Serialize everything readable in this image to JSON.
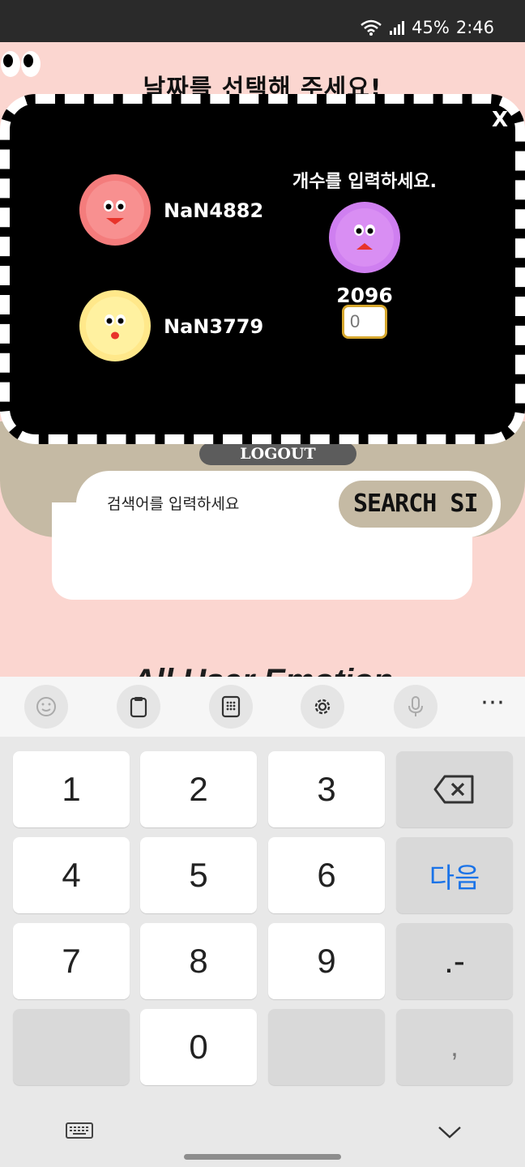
{
  "status_bar": {
    "battery": "45%",
    "time": "2:46"
  },
  "page": {
    "title": "날짜를 선택해 주세요!",
    "logout_label": "LOGOUT",
    "search": {
      "placeholder": "검색어를 입력하세요",
      "button_label": "SEARCH SI"
    },
    "section_title": "All User Emotion"
  },
  "modal": {
    "close_label": "X",
    "rows": [
      {
        "label": "NaN4882",
        "face": "red-happy-face-icon",
        "color": "#f47c7c"
      },
      {
        "label": "NaN3779",
        "face": "yellow-surprised-face-icon",
        "color": "#ffe88a"
      }
    ],
    "count": {
      "title": "개수를 입력하세요.",
      "face": "purple-face-icon",
      "color": "#cf7ff0",
      "value": "2096",
      "input_placeholder": "0"
    }
  },
  "keyboard": {
    "toolbar": [
      "emoji-icon",
      "clipboard-icon",
      "keypad-icon",
      "settings-icon",
      "microphone-icon",
      "more-icon"
    ],
    "keys": {
      "k1": "1",
      "k2": "2",
      "k3": "3",
      "k4": "4",
      "k5": "5",
      "k6": "6",
      "next": "다음",
      "k7": "7",
      "k8": "8",
      "k9": "9",
      "dot_dash": ".-",
      "k0": "0",
      "comma": ","
    }
  }
}
